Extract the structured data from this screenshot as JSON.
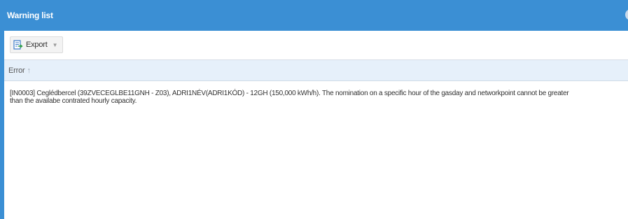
{
  "window": {
    "title": "Warning list",
    "close_icon": "close-icon",
    "accent_color": "#3b8fd4"
  },
  "toolbar": {
    "export_label": "Export",
    "export_icon": "export-icon",
    "dropdown_icon": "chevron-down-icon"
  },
  "grid": {
    "columns": [
      {
        "label": "Error",
        "sort": "ascending"
      }
    ],
    "rows": [
      {
        "error": "[IN0003] Ceglédbercel (39ZVECEGLBE11GNH - Z03), ADRI1NÉV(ADRI1KÓD) - 12GH (150,000 kWh/h). The nomination on a specific hour of the gasday and networkpoint cannot be greater than the availabe contrated hourly capacity."
      }
    ]
  }
}
